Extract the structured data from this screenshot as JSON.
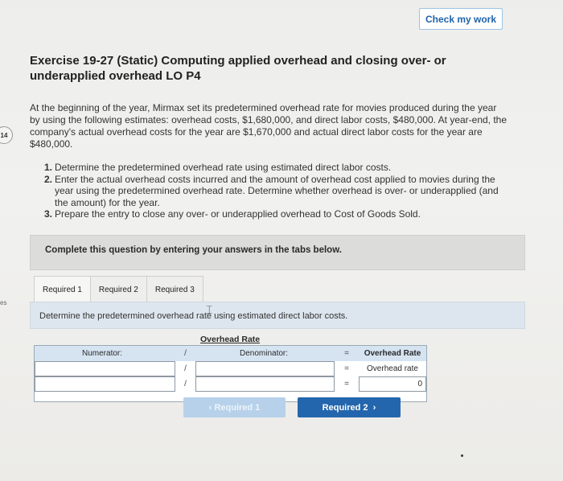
{
  "side": {
    "badge": "14",
    "fragment": "es"
  },
  "header": {
    "check_button": "Check my work"
  },
  "exercise": {
    "title": "Exercise 19-27 (Static) Computing applied overhead and closing over- or underapplied overhead LO P4",
    "intro": "At the beginning of the year, Mirmax set its predetermined overhead rate for movies produced during the year by using the following estimates: overhead costs, $1,680,000, and direct labor costs, $480,000. At year-end, the company's actual overhead costs for the year are $1,670,000 and actual direct labor costs for the year are $480,000.",
    "steps": [
      {
        "num": "1.",
        "text": "Determine the predetermined overhead rate using estimated direct labor costs."
      },
      {
        "num": "2.",
        "text": "Enter the actual overhead costs incurred and the amount of overhead cost applied to movies during the year using the predetermined overhead rate. Determine whether overhead is over- or underapplied (and the amount) for the year."
      },
      {
        "num": "3.",
        "text": "Prepare the entry to close any over- or underapplied overhead to Cost of Goods Sold."
      }
    ]
  },
  "complete_prompt": "Complete this question by entering your answers in the tabs below.",
  "tabs": [
    "Required 1",
    "Required 2",
    "Required 3"
  ],
  "instruction": "Determine the predetermined overhead rate using estimated direct labor costs.",
  "rate_table": {
    "title": "Overhead Rate",
    "numerator_label": "Numerator:",
    "denominator_label": "Denominator:",
    "divide_sign": "/",
    "equals_sign": "=",
    "result_header": "Overhead Rate",
    "result_row1": "Overhead rate",
    "result_row2": "0"
  },
  "navigation": {
    "prev_label": "Required 1",
    "next_label": "Required 2"
  },
  "colors": {
    "accent": "#2466ad",
    "header_fill": "#d6e4f2"
  }
}
